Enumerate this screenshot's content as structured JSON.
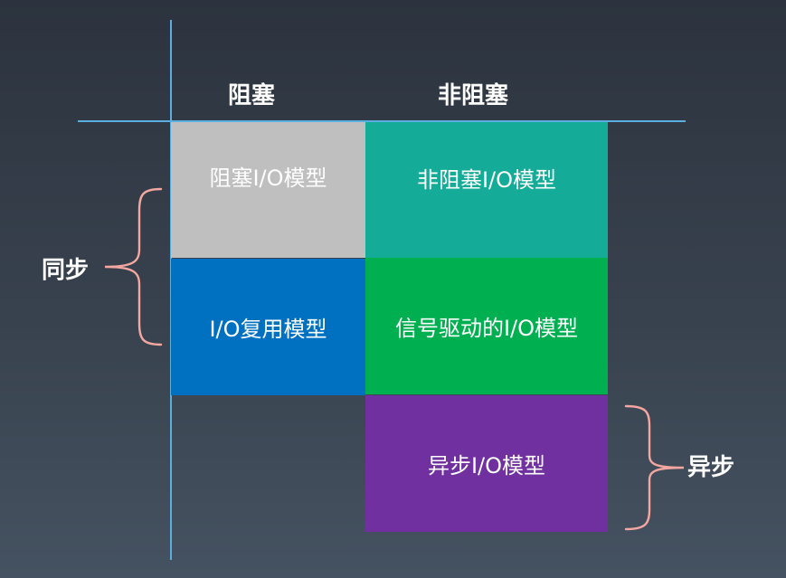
{
  "columns": {
    "blocking": "阻塞",
    "non_blocking": "非阻塞"
  },
  "rows": {
    "sync": "同步",
    "async": "异步"
  },
  "cells": {
    "blocking_io": "阻塞I/O模型",
    "non_blocking_io": "非阻塞I/O模型",
    "io_multiplexing": "I/O复用模型",
    "signal_driven_io": "信号驱动的I/O模型",
    "async_io": "异步I/O模型"
  },
  "colors": {
    "axis": "#5aaee0",
    "brace": "#f4a7a0",
    "blocking_io": "#bfbfbf",
    "non_blocking_io": "#14ac98",
    "io_multiplexing": "#0070c0",
    "signal_driven_io": "#00b050",
    "async_io": "#7030a0"
  }
}
